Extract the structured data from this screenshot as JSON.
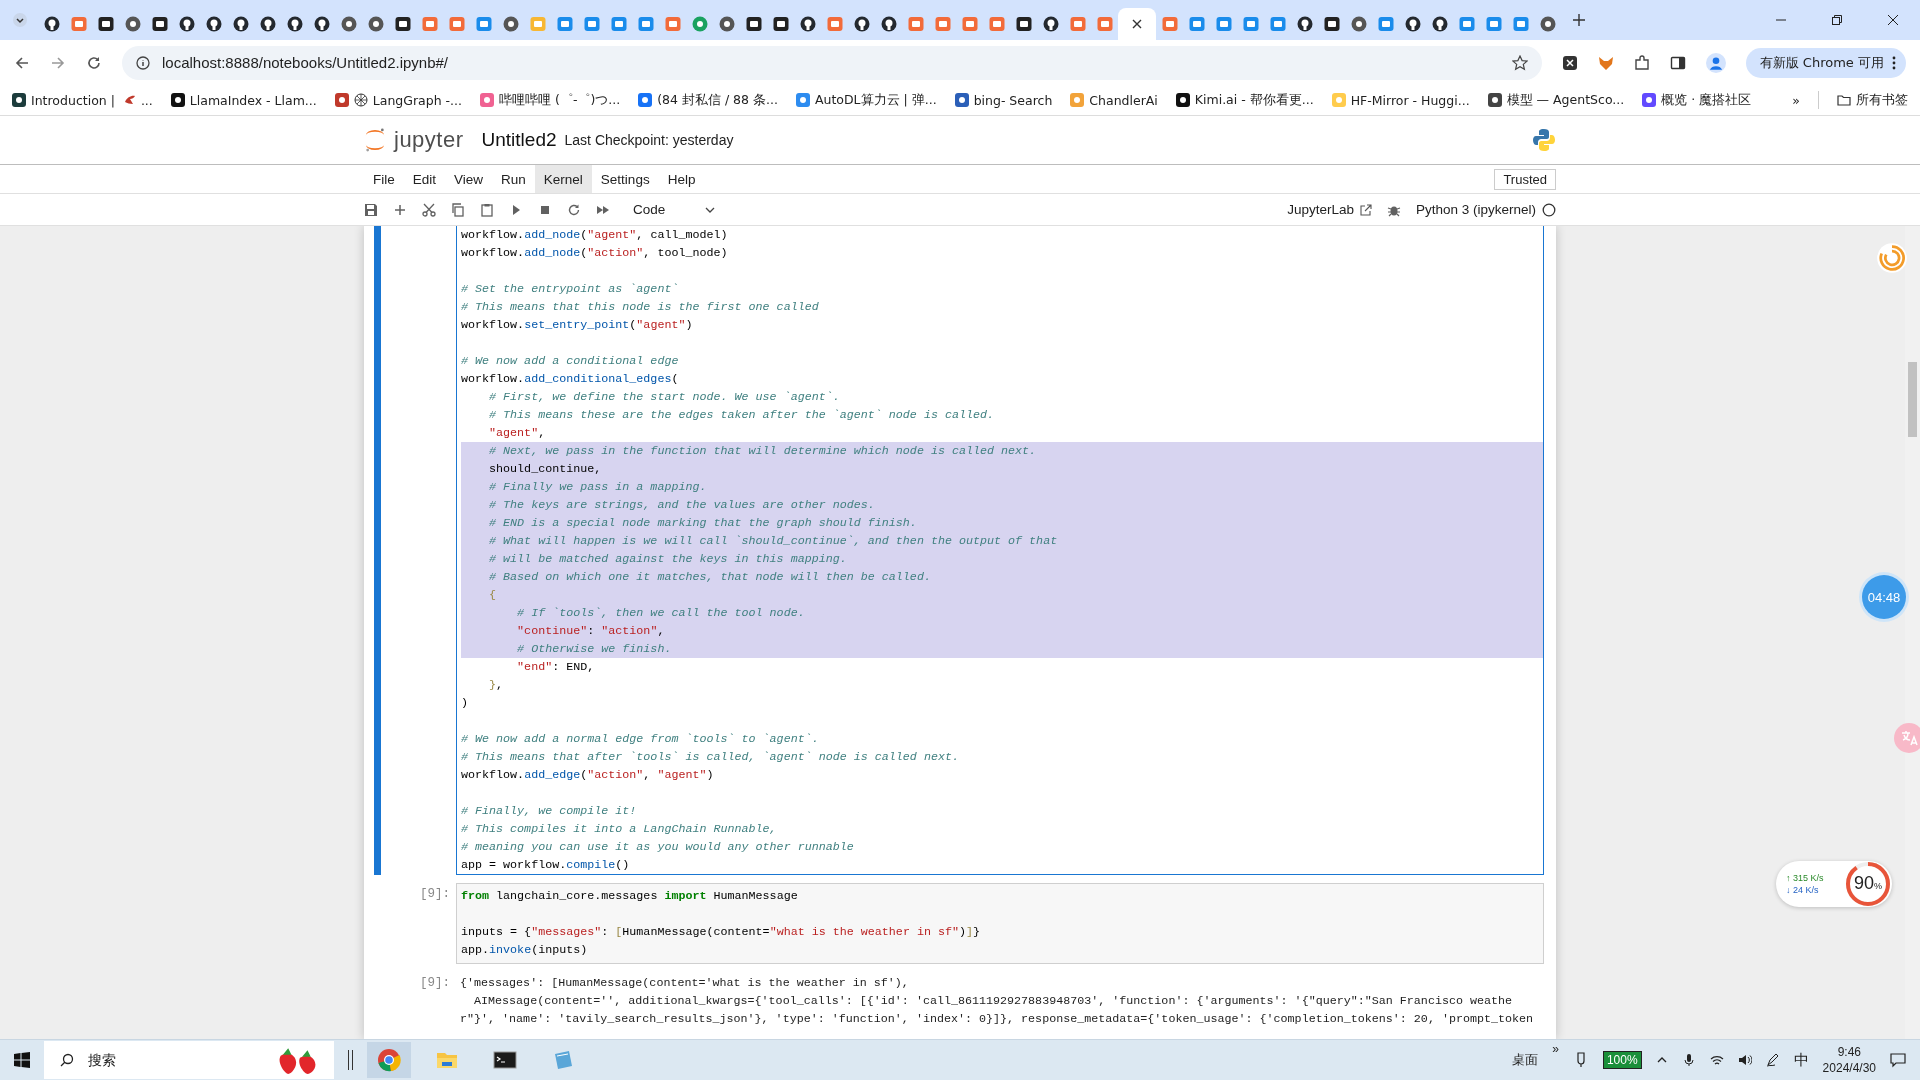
{
  "browser": {
    "tabs": [
      {
        "kind": "github",
        "selected": false
      },
      {
        "kind": "orange",
        "selected": false
      },
      {
        "kind": "dark",
        "selected": false
      },
      {
        "kind": "gray",
        "selected": false
      },
      {
        "kind": "dark",
        "selected": false
      },
      {
        "kind": "github",
        "selected": false
      },
      {
        "kind": "github",
        "selected": false
      },
      {
        "kind": "github",
        "selected": false
      },
      {
        "kind": "github",
        "selected": false
      },
      {
        "kind": "github",
        "selected": false
      },
      {
        "kind": "github",
        "selected": false
      },
      {
        "kind": "gray",
        "selected": false
      },
      {
        "kind": "gray",
        "selected": false
      },
      {
        "kind": "dark",
        "selected": false
      },
      {
        "kind": "orange",
        "selected": false
      },
      {
        "kind": "orange",
        "selected": false
      },
      {
        "kind": "blue",
        "selected": false
      },
      {
        "kind": "gray",
        "selected": false
      },
      {
        "kind": "yellow",
        "selected": false
      },
      {
        "kind": "blue",
        "selected": false
      },
      {
        "kind": "blue",
        "selected": false
      },
      {
        "kind": "blue",
        "selected": false
      },
      {
        "kind": "blue",
        "selected": false
      },
      {
        "kind": "orange",
        "selected": false
      },
      {
        "kind": "green",
        "selected": false
      },
      {
        "kind": "gray",
        "selected": false
      },
      {
        "kind": "dark",
        "selected": false
      },
      {
        "kind": "dark",
        "selected": false
      },
      {
        "kind": "github",
        "selected": false
      },
      {
        "kind": "orange",
        "selected": false
      },
      {
        "kind": "github",
        "selected": false
      },
      {
        "kind": "github",
        "selected": false
      },
      {
        "kind": "orange",
        "selected": false
      },
      {
        "kind": "orange",
        "selected": false
      },
      {
        "kind": "orange",
        "selected": false
      },
      {
        "kind": "orange",
        "selected": false
      },
      {
        "kind": "dark",
        "selected": false
      },
      {
        "kind": "github",
        "selected": false
      },
      {
        "kind": "orange",
        "selected": false
      },
      {
        "kind": "orange",
        "selected": false
      },
      {
        "selected": true
      },
      {
        "kind": "orange",
        "selected": false
      },
      {
        "kind": "blue",
        "selected": false
      },
      {
        "kind": "blue",
        "selected": false
      },
      {
        "kind": "blue",
        "selected": false
      },
      {
        "kind": "blue",
        "selected": false
      },
      {
        "kind": "github",
        "selected": false
      },
      {
        "kind": "dark",
        "selected": false
      },
      {
        "kind": "gray",
        "selected": false
      },
      {
        "kind": "blue",
        "selected": false
      },
      {
        "kind": "github",
        "selected": false
      },
      {
        "kind": "github",
        "selected": false
      },
      {
        "kind": "blue",
        "selected": false
      },
      {
        "kind": "blue",
        "selected": false
      },
      {
        "kind": "blue",
        "selected": false
      },
      {
        "kind": "gray",
        "selected": false
      }
    ],
    "url": "localhost:8888/notebooks/Untitled2.ipynb#/",
    "update_button": "有新版 Chrome 可用",
    "bookmarks": [
      {
        "kind": "langchain",
        "label": "Introduction |",
        "trail": "..."
      },
      {
        "kind": "llama",
        "label": "LlamaIndex - Llam..."
      },
      {
        "kind": "langgraph",
        "label": "LangGraph -..."
      },
      {
        "kind": "bili",
        "label": "哔哩哔哩 (゜-゜)つ..."
      },
      {
        "kind": "zhihu",
        "label": "(84 封私信 / 88 条..."
      },
      {
        "kind": "autodl",
        "label": "AutoDL算力云 | 弹..."
      },
      {
        "kind": "search",
        "label": "bing- Search"
      },
      {
        "kind": "chandler",
        "label": "ChandlerAi"
      },
      {
        "kind": "kimi",
        "label": "Kimi.ai - 帮你看更..."
      },
      {
        "kind": "hf",
        "label": "HF-Mirror - Huggi..."
      },
      {
        "kind": "globe",
        "label": "模型 — AgentSco..."
      },
      {
        "kind": "modelscope",
        "label": "概览 · 魔搭社区"
      }
    ],
    "more": "»",
    "all_bookmarks": "所有书签"
  },
  "notebook": {
    "logo": "jupyter",
    "title": "Untitled2",
    "checkpoint": "Last Checkpoint: yesterday",
    "menu": [
      {
        "label": "File",
        "selected": false
      },
      {
        "label": "Edit",
        "selected": false
      },
      {
        "label": "View",
        "selected": false
      },
      {
        "label": "Run",
        "selected": false
      },
      {
        "label": "Kernel",
        "selected": true
      },
      {
        "label": "Settings",
        "selected": false
      },
      {
        "label": "Help",
        "selected": false
      }
    ],
    "trusted": "Trusted",
    "cell_type": "Code",
    "jupyterlab": "JupyterLab",
    "kernel": "Python 3 (ipykernel)",
    "cells": [
      {
        "kind": "code",
        "active": true,
        "lines": [
          {
            "selected": false,
            "tokens": [
              {
                "kind": "plain",
                "text": "workflow."
              },
              {
                "kind": "attr",
                "text": "add_node"
              },
              {
                "kind": "plain",
                "text": "("
              },
              {
                "kind": "string",
                "text": "\"agent\""
              },
              {
                "kind": "plain",
                "text": ", call_model)"
              }
            ]
          },
          {
            "selected": false,
            "tokens": [
              {
                "kind": "plain",
                "text": "workflow."
              },
              {
                "kind": "attr",
                "text": "add_node"
              },
              {
                "kind": "plain",
                "text": "("
              },
              {
                "kind": "string",
                "text": "\"action\""
              },
              {
                "kind": "plain",
                "text": ", tool_node)"
              }
            ]
          },
          {
            "selected": false
          },
          {
            "selected": false,
            "tokens": [
              {
                "kind": "comment",
                "text": "# Set the entrypoint as `agent`"
              }
            ]
          },
          {
            "selected": false,
            "tokens": [
              {
                "kind": "comment",
                "text": "# This means that this node is the first one called"
              }
            ]
          },
          {
            "selected": false,
            "tokens": [
              {
                "kind": "plain",
                "text": "workflow."
              },
              {
                "kind": "attr",
                "text": "set_entry_point"
              },
              {
                "kind": "plain",
                "text": "("
              },
              {
                "kind": "string",
                "text": "\"agent\""
              },
              {
                "kind": "plain",
                "text": ")"
              }
            ]
          },
          {
            "selected": false
          },
          {
            "selected": false,
            "tokens": [
              {
                "kind": "comment",
                "text": "# We now add a conditional edge"
              }
            ]
          },
          {
            "selected": false,
            "tokens": [
              {
                "kind": "plain",
                "text": "workflow."
              },
              {
                "kind": "attr",
                "text": "add_conditional_edges"
              },
              {
                "kind": "plain",
                "text": "("
              }
            ]
          },
          {
            "selected": false,
            "tokens": [
              {
                "kind": "comment",
                "text": "    # First, we define the start node. We use `agent`."
              }
            ]
          },
          {
            "selected": false,
            "tokens": [
              {
                "kind": "comment",
                "text": "    # This means these are the edges taken after the `agent` node is called."
              }
            ]
          },
          {
            "selected": false,
            "tokens": [
              {
                "kind": "string",
                "text": "    \"agent\""
              },
              {
                "kind": "plain",
                "text": ","
              }
            ]
          },
          {
            "selected": true,
            "tokens": [
              {
                "kind": "comment",
                "text": "    # Next, we pass in the function that will determine which node is called next."
              }
            ]
          },
          {
            "selected": true,
            "tokens": [
              {
                "kind": "plain",
                "text": "    should_continue,"
              }
            ]
          },
          {
            "selected": true,
            "tokens": [
              {
                "kind": "comment",
                "text": "    # Finally we pass in a mapping."
              }
            ]
          },
          {
            "selected": true,
            "tokens": [
              {
                "kind": "comment",
                "text": "    # The keys are strings, and the values are other nodes."
              }
            ]
          },
          {
            "selected": true,
            "tokens": [
              {
                "kind": "comment",
                "text": "    # END is a special node marking that the graph should finish."
              }
            ]
          },
          {
            "selected": true,
            "tokens": [
              {
                "kind": "comment",
                "text": "    # What will happen is we will call `should_continue`, and then the output of that"
              }
            ]
          },
          {
            "selected": true,
            "tokens": [
              {
                "kind": "comment",
                "text": "    # will be matched against the keys in this mapping."
              }
            ]
          },
          {
            "selected": true,
            "tokens": [
              {
                "kind": "comment",
                "text": "    # Based on which one it matches, that node will then be called."
              }
            ]
          },
          {
            "selected": true,
            "tokens": [
              {
                "kind": "bracket",
                "text": "    {"
              }
            ]
          },
          {
            "selected": true,
            "tokens": [
              {
                "kind": "comment",
                "text": "        # If `tools`, then we call the tool node."
              }
            ]
          },
          {
            "selected": true,
            "tokens": [
              {
                "kind": "string",
                "text": "        \"continue\""
              },
              {
                "kind": "plain",
                "text": ": "
              },
              {
                "kind": "string",
                "text": "\"action\""
              },
              {
                "kind": "plain",
                "text": ","
              }
            ]
          },
          {
            "selected": true,
            "tokens": [
              {
                "kind": "comment",
                "text": "        # Otherwise we finish."
              }
            ]
          },
          {
            "selected": false,
            "tokens": [
              {
                "kind": "string",
                "text": "        \"end\""
              },
              {
                "kind": "plain",
                "text": ": END,"
              }
            ]
          },
          {
            "selected": false,
            "tokens": [
              {
                "kind": "bracket",
                "text": "    }"
              },
              {
                "kind": "plain",
                "text": ","
              }
            ]
          },
          {
            "selected": false,
            "tokens": [
              {
                "kind": "plain",
                "text": ")"
              }
            ]
          },
          {
            "selected": false
          },
          {
            "selected": false,
            "tokens": [
              {
                "kind": "comment",
                "text": "# We now add a normal edge from `tools` to `agent`."
              }
            ]
          },
          {
            "selected": false,
            "tokens": [
              {
                "kind": "comment",
                "text": "# This means that after `tools` is called, `agent` node is called next."
              }
            ]
          },
          {
            "selected": false,
            "tokens": [
              {
                "kind": "plain",
                "text": "workflow."
              },
              {
                "kind": "attr",
                "text": "add_edge"
              },
              {
                "kind": "plain",
                "text": "("
              },
              {
                "kind": "string",
                "text": "\"action\""
              },
              {
                "kind": "plain",
                "text": ", "
              },
              {
                "kind": "string",
                "text": "\"agent\""
              },
              {
                "kind": "plain",
                "text": ")"
              }
            ]
          },
          {
            "selected": false
          },
          {
            "selected": false,
            "tokens": [
              {
                "kind": "comment",
                "text": "# Finally, we compile it!"
              }
            ]
          },
          {
            "selected": false,
            "tokens": [
              {
                "kind": "comment",
                "text": "# This compiles it into a LangChain Runnable,"
              }
            ]
          },
          {
            "selected": false,
            "tokens": [
              {
                "kind": "comment",
                "text": "# meaning you can use it as you would any other runnable"
              }
            ]
          },
          {
            "selected": false,
            "tokens": [
              {
                "kind": "plain",
                "text": "app = workflow."
              },
              {
                "kind": "attr",
                "text": "compile"
              },
              {
                "kind": "plain",
                "text": "()"
              }
            ]
          }
        ]
      },
      {
        "kind": "code",
        "prompt": "[9]:",
        "lines": [
          {
            "selected": false,
            "tokens": [
              {
                "kind": "keyword",
                "text": "from"
              },
              {
                "kind": "plain",
                "text": " langchain_core.messages "
              },
              {
                "kind": "keyword",
                "text": "import"
              },
              {
                "kind": "plain",
                "text": " HumanMessage"
              }
            ]
          },
          {
            "selected": false
          },
          {
            "selected": false,
            "tokens": [
              {
                "kind": "plain",
                "text": "inputs = {"
              },
              {
                "kind": "string",
                "text": "\"messages\""
              },
              {
                "kind": "plain",
                "text": ": "
              },
              {
                "kind": "bracket",
                "text": "["
              },
              {
                "kind": "plain",
                "text": "HumanMessage(content="
              },
              {
                "kind": "string",
                "text": "\"what is the weather in sf\""
              },
              {
                "kind": "plain",
                "text": ")"
              },
              {
                "kind": "bracket",
                "text": "]"
              },
              {
                "kind": "plain",
                "text": "}"
              }
            ]
          },
          {
            "selected": false,
            "tokens": [
              {
                "kind": "plain",
                "text": "app."
              },
              {
                "kind": "attr",
                "text": "invoke"
              },
              {
                "kind": "plain",
                "text": "(inputs)"
              }
            ]
          }
        ]
      },
      {
        "kind": "output",
        "prompt": "[9]:",
        "text_lines": [
          "{'messages': [HumanMessage(content='what is the weather in sf'),",
          "  AIMessage(content='', additional_kwargs={'tool_calls': [{'id': 'call_8611192927883948703', 'function': {'arguments': '{\"query\":\"San Francisco weathe",
          "r\"}', 'name': 'tavily_search_results_json'}, 'type': 'function', 'index': 0}]}, response_metadata={'token_usage': {'completion_tokens': 20, 'prompt_token"
        ]
      }
    ]
  },
  "overlays": {
    "timer": "04:48",
    "net_up": "↑ 315 K/s",
    "net_down": "↓ 24 K/s",
    "gauge_value": "90",
    "gauge_unit": "%",
    "level": 0.9
  },
  "taskbar": {
    "search_placeholder": "搜索",
    "desktop": "桌面",
    "overflow": "»",
    "battery": "100%",
    "ime": "中",
    "time": "9:46",
    "date": "2024/4/30"
  }
}
